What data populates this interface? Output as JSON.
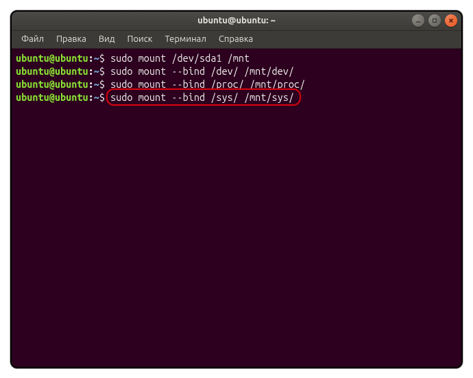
{
  "window": {
    "title": "ubuntu@ubuntu: ~"
  },
  "menubar": {
    "items": [
      "Файл",
      "Правка",
      "Вид",
      "Поиск",
      "Терминал",
      "Справка"
    ]
  },
  "prompt": {
    "user_host": "ubuntu@ubuntu",
    "colon": ":",
    "path": "~",
    "dollar": "$"
  },
  "commands": {
    "0": "sudo mount /dev/sda1 /mnt",
    "1": "sudo mount --bind /dev/ /mnt/dev/",
    "2": "sudo mount --bind /proc/ /mnt/proc/",
    "3": "sudo mount --bind /sys/ /mnt/sys/"
  },
  "icons": {
    "min": "–",
    "max": "□",
    "close": "×"
  }
}
